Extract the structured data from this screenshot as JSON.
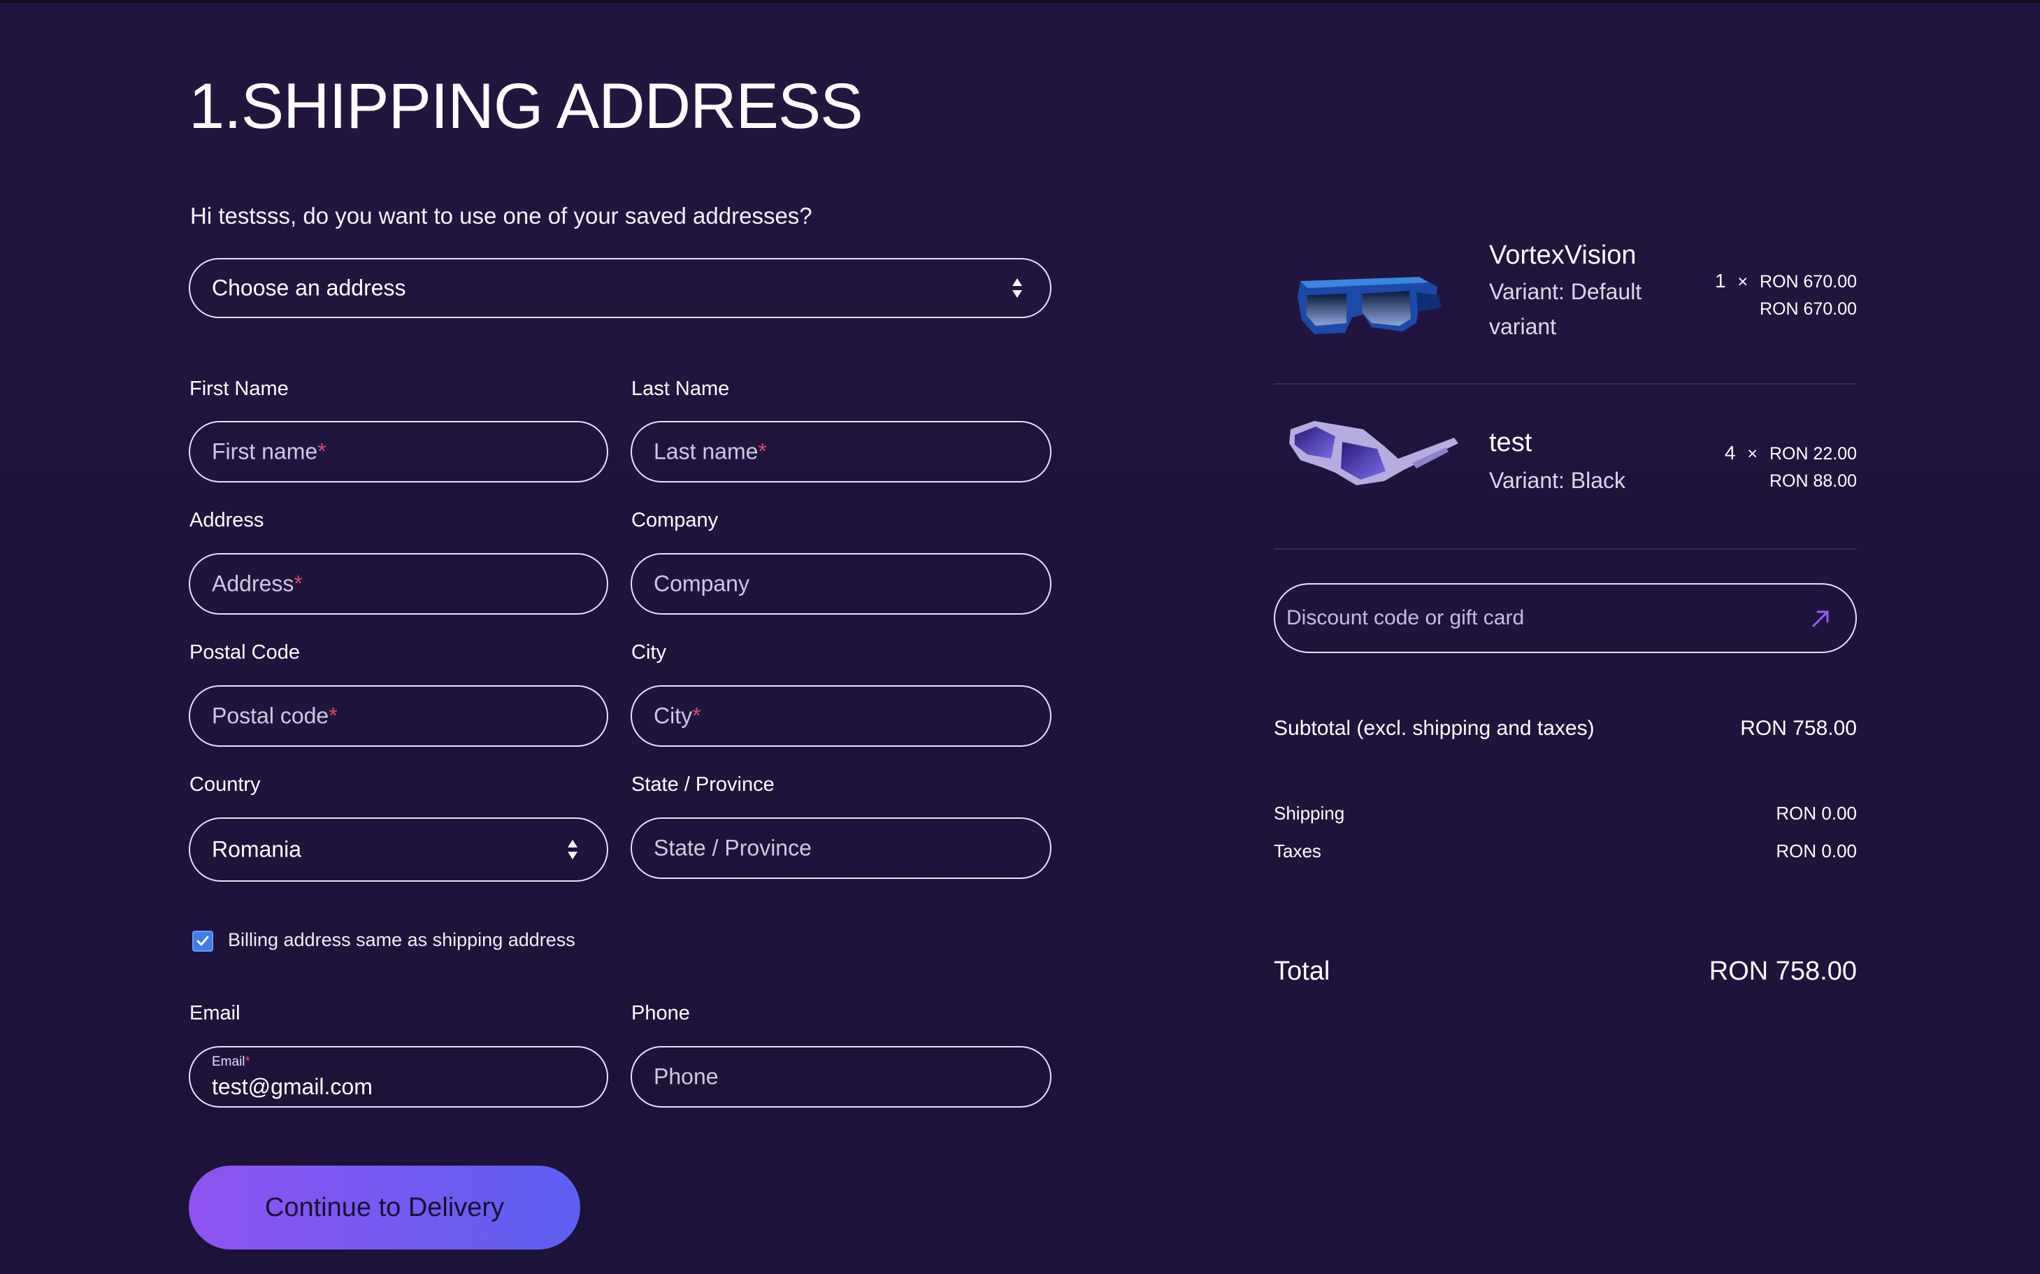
{
  "page": {
    "title": "1.SHIPPING ADDRESS",
    "greeting": "Hi testsss, do you want to use one of your saved addresses?"
  },
  "saved_address_select": {
    "value": "Choose an address"
  },
  "form": {
    "first_name": {
      "label": "First Name",
      "placeholder": "First name",
      "required": "*"
    },
    "last_name": {
      "label": "Last Name",
      "placeholder": "Last name",
      "required": "*"
    },
    "address": {
      "label": "Address",
      "placeholder": "Address",
      "required": "*"
    },
    "company": {
      "label": "Company",
      "placeholder": "Company"
    },
    "postal_code": {
      "label": "Postal Code",
      "placeholder": "Postal code",
      "required": "*"
    },
    "city": {
      "label": "City",
      "placeholder": "City",
      "required": "*"
    },
    "country": {
      "label": "Country",
      "value": "Romania"
    },
    "state": {
      "label": "State / Province",
      "placeholder": "State / Province"
    },
    "billing_same": {
      "label": "Billing address same as shipping address",
      "checked": true
    },
    "email": {
      "label": "Email",
      "floating_label": "Email",
      "required": "*",
      "value": "test@gmail.com"
    },
    "phone": {
      "label": "Phone",
      "placeholder": "Phone"
    },
    "submit_label": "Continue to Delivery"
  },
  "cart": {
    "items": [
      {
        "name": "VortexVision",
        "variant": "Variant: Default variant",
        "quantity": "1",
        "times": "×",
        "unit_price": "RON 670.00",
        "line_total": "RON 670.00",
        "thumb_icon": "sunglasses-blue-icon"
      },
      {
        "name": "test",
        "variant": "Variant: Black",
        "quantity": "4",
        "times": "×",
        "unit_price": "RON 22.00",
        "line_total": "RON 88.00",
        "thumb_icon": "sunglasses-purple-icon"
      }
    ],
    "discount_placeholder": "Discount code or gift card",
    "subtotal_label": "Subtotal (excl. shipping and taxes)",
    "subtotal_value": "RON 758.00",
    "shipping_label": "Shipping",
    "shipping_value": "RON 0.00",
    "taxes_label": "Taxes",
    "taxes_value": "RON 0.00",
    "total_label": "Total",
    "total_value": "RON 758.00"
  },
  "colors": {
    "background": "#221640",
    "cta_gradient_start": "#8f53ef",
    "cta_gradient_end": "#5d60f1",
    "required": "#d34a72",
    "checkbox": "#3e7ce8",
    "discount_arrow": "#9b5cf0"
  }
}
